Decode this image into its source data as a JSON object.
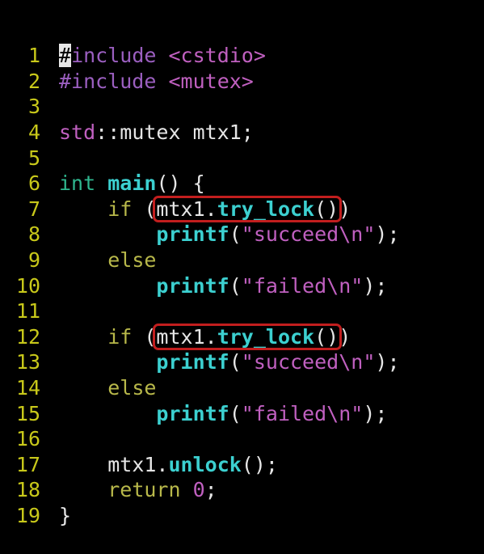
{
  "editor": {
    "lines": [
      {
        "num": "1",
        "tokens": [
          {
            "text": "#",
            "cls": "t-cursor"
          },
          {
            "text": "include",
            "cls": "t-prep"
          },
          {
            "text": " ",
            "cls": "t-plain"
          },
          {
            "text": "<cstdio>",
            "cls": "t-inc"
          }
        ]
      },
      {
        "num": "2",
        "tokens": [
          {
            "text": "#include",
            "cls": "t-prep"
          },
          {
            "text": " ",
            "cls": "t-plain"
          },
          {
            "text": "<mutex>",
            "cls": "t-inc"
          }
        ]
      },
      {
        "num": "3",
        "tokens": []
      },
      {
        "num": "4",
        "tokens": [
          {
            "text": "std",
            "cls": "t-ns"
          },
          {
            "text": "::",
            "cls": "t-plain"
          },
          {
            "text": "mutex",
            "cls": "t-plain"
          },
          {
            "text": " mtx1;",
            "cls": "t-plain"
          }
        ]
      },
      {
        "num": "5",
        "tokens": []
      },
      {
        "num": "6",
        "tokens": [
          {
            "text": "int",
            "cls": "t-type"
          },
          {
            "text": " ",
            "cls": "t-plain"
          },
          {
            "text": "main",
            "cls": "t-fn"
          },
          {
            "text": "() {",
            "cls": "t-plain"
          }
        ]
      },
      {
        "num": "7",
        "tokens": [
          {
            "text": "    ",
            "cls": "t-plain"
          },
          {
            "text": "if",
            "cls": "t-kw"
          },
          {
            "text": " (mtx1.",
            "cls": "t-plain"
          },
          {
            "text": "try_lock",
            "cls": "t-fn"
          },
          {
            "text": "())",
            "cls": "t-plain"
          }
        ]
      },
      {
        "num": "8",
        "tokens": [
          {
            "text": "        ",
            "cls": "t-plain"
          },
          {
            "text": "printf",
            "cls": "t-fn"
          },
          {
            "text": "(",
            "cls": "t-plain"
          },
          {
            "text": "\"succeed",
            "cls": "t-str"
          },
          {
            "text": "\\n",
            "cls": "t-esc"
          },
          {
            "text": "\"",
            "cls": "t-str"
          },
          {
            "text": ");",
            "cls": "t-plain"
          }
        ]
      },
      {
        "num": "9",
        "tokens": [
          {
            "text": "    ",
            "cls": "t-plain"
          },
          {
            "text": "else",
            "cls": "t-kw"
          }
        ]
      },
      {
        "num": "10",
        "tokens": [
          {
            "text": "        ",
            "cls": "t-plain"
          },
          {
            "text": "printf",
            "cls": "t-fn"
          },
          {
            "text": "(",
            "cls": "t-plain"
          },
          {
            "text": "\"failed",
            "cls": "t-str"
          },
          {
            "text": "\\n",
            "cls": "t-esc"
          },
          {
            "text": "\"",
            "cls": "t-str"
          },
          {
            "text": ");",
            "cls": "t-plain"
          }
        ]
      },
      {
        "num": "11",
        "tokens": []
      },
      {
        "num": "12",
        "tokens": [
          {
            "text": "    ",
            "cls": "t-plain"
          },
          {
            "text": "if",
            "cls": "t-kw"
          },
          {
            "text": " (mtx1.",
            "cls": "t-plain"
          },
          {
            "text": "try_lock",
            "cls": "t-fn"
          },
          {
            "text": "())",
            "cls": "t-plain"
          }
        ]
      },
      {
        "num": "13",
        "tokens": [
          {
            "text": "        ",
            "cls": "t-plain"
          },
          {
            "text": "printf",
            "cls": "t-fn"
          },
          {
            "text": "(",
            "cls": "t-plain"
          },
          {
            "text": "\"succeed",
            "cls": "t-str"
          },
          {
            "text": "\\n",
            "cls": "t-esc"
          },
          {
            "text": "\"",
            "cls": "t-str"
          },
          {
            "text": ");",
            "cls": "t-plain"
          }
        ]
      },
      {
        "num": "14",
        "tokens": [
          {
            "text": "    ",
            "cls": "t-plain"
          },
          {
            "text": "else",
            "cls": "t-kw"
          }
        ]
      },
      {
        "num": "15",
        "tokens": [
          {
            "text": "        ",
            "cls": "t-plain"
          },
          {
            "text": "printf",
            "cls": "t-fn"
          },
          {
            "text": "(",
            "cls": "t-plain"
          },
          {
            "text": "\"failed",
            "cls": "t-str"
          },
          {
            "text": "\\n",
            "cls": "t-esc"
          },
          {
            "text": "\"",
            "cls": "t-str"
          },
          {
            "text": ");",
            "cls": "t-plain"
          }
        ]
      },
      {
        "num": "16",
        "tokens": []
      },
      {
        "num": "17",
        "tokens": [
          {
            "text": "    ",
            "cls": "t-plain"
          },
          {
            "text": "mtx1.",
            "cls": "t-plain"
          },
          {
            "text": "unlock",
            "cls": "t-fn"
          },
          {
            "text": "();",
            "cls": "t-plain"
          }
        ]
      },
      {
        "num": "18",
        "tokens": [
          {
            "text": "    ",
            "cls": "t-plain"
          },
          {
            "text": "return",
            "cls": "t-kw"
          },
          {
            "text": " ",
            "cls": "t-plain"
          },
          {
            "text": "0",
            "cls": "t-num"
          },
          {
            "text": ";",
            "cls": "t-plain"
          }
        ]
      },
      {
        "num": "19",
        "tokens": [
          {
            "text": "}",
            "cls": "t-plain"
          }
        ]
      }
    ],
    "highlights": [
      {
        "line_index": 6
      },
      {
        "line_index": 11
      }
    ]
  }
}
